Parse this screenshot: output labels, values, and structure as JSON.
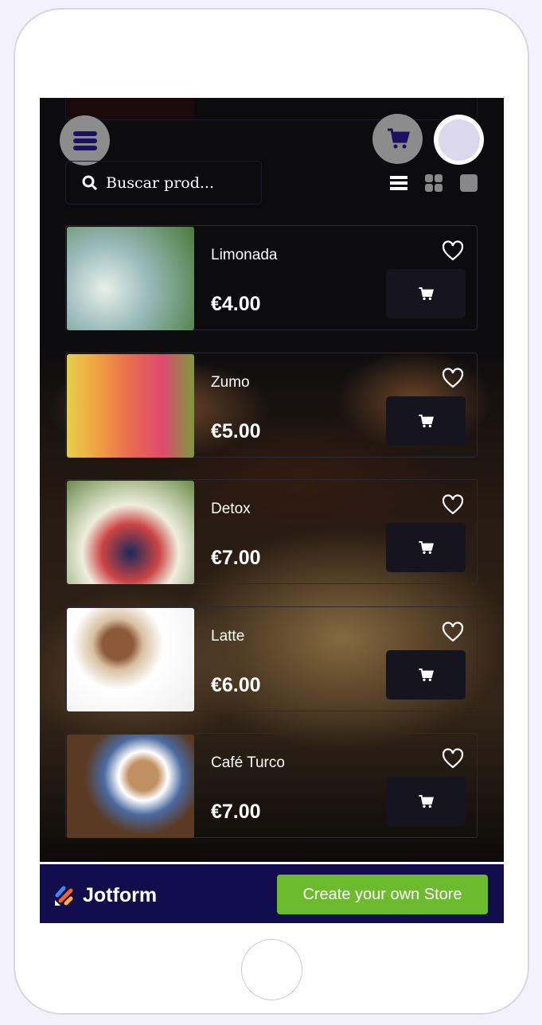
{
  "header": {
    "search_placeholder": "Buscar prod...",
    "icons": [
      "menu-icon",
      "cart-icon",
      "avatar-icon",
      "list-view-icon",
      "grid-view-icon",
      "single-view-icon"
    ]
  },
  "products": [
    {
      "name": "Limonada",
      "price": "€4.00"
    },
    {
      "name": "Zumo",
      "price": "€5.00"
    },
    {
      "name": "Detox",
      "price": "€7.00"
    },
    {
      "name": "Latte",
      "price": "€6.00"
    },
    {
      "name": "Café Turco",
      "price": "€7.00"
    }
  ],
  "footer": {
    "brand": "Jotform",
    "cta": "Create your own Store"
  },
  "colors": {
    "footer_bg": "#120d4d",
    "cta_bg": "#6cbb2e",
    "icon_navy": "#1a1260"
  }
}
